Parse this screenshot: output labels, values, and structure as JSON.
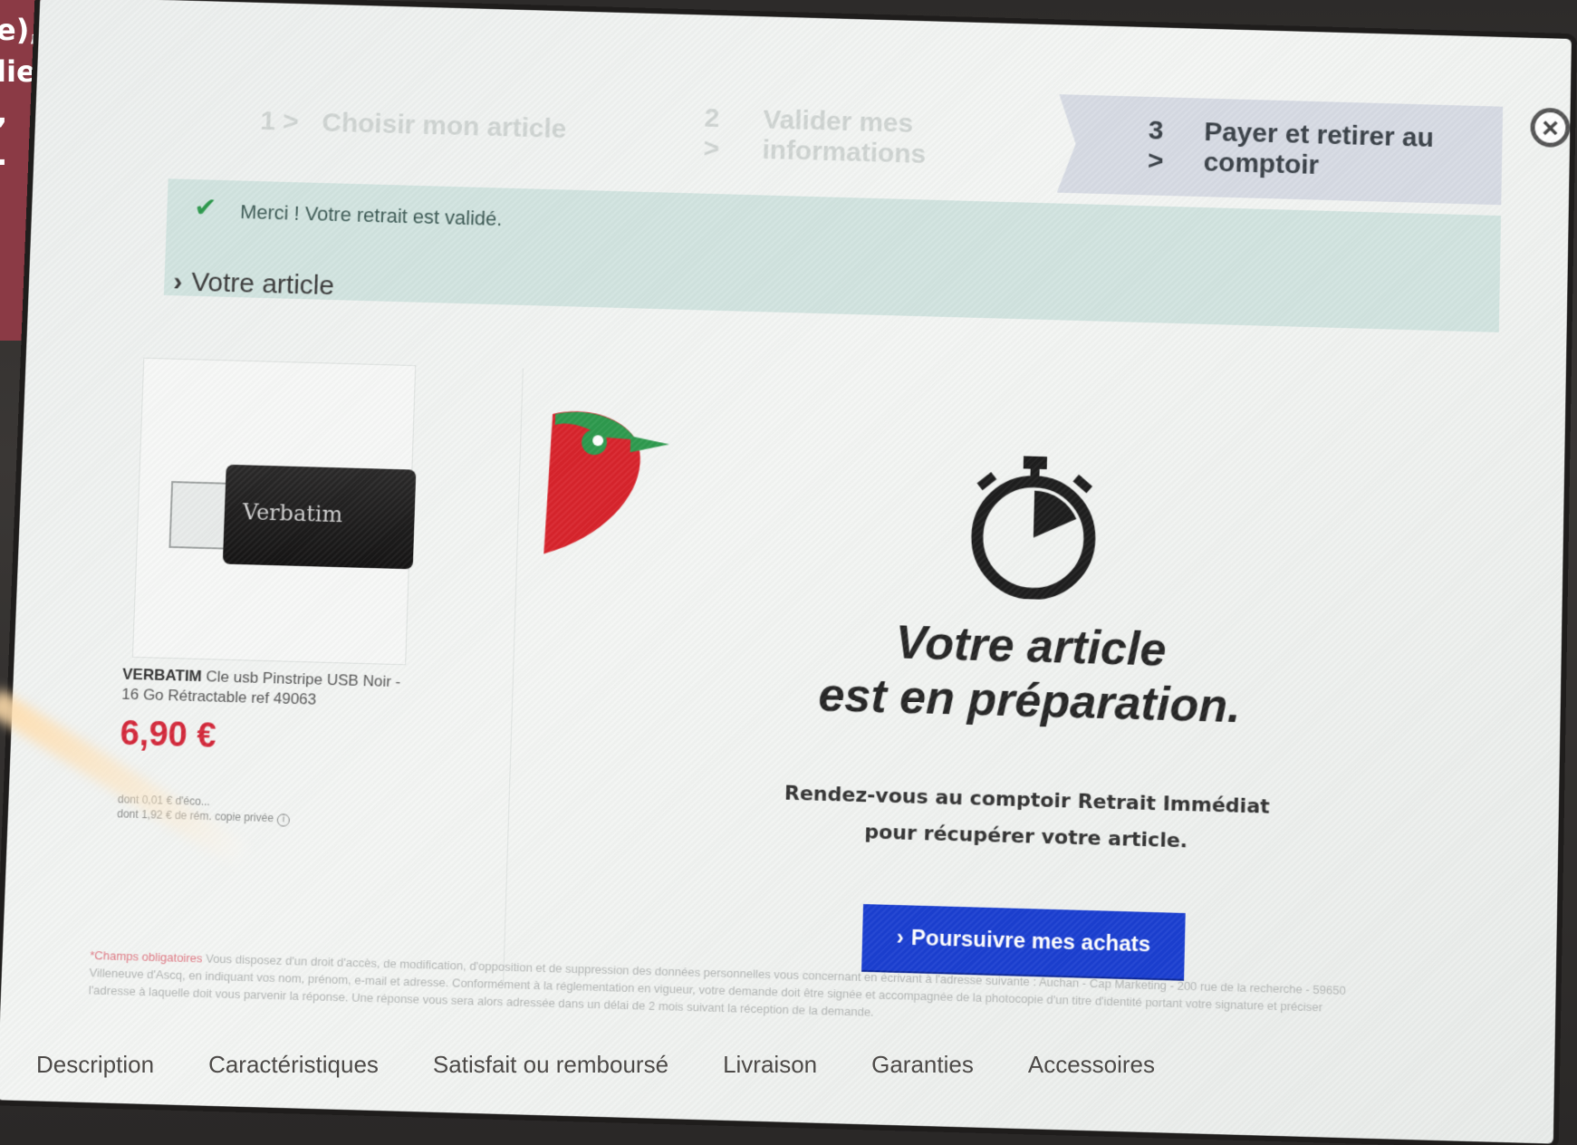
{
  "overlay": {
    "lines": [
      "e),",
      "lient",
      ",",
      "."
    ]
  },
  "wizard": {
    "steps": [
      {
        "num": "1 >",
        "label": "Choisir mon article"
      },
      {
        "num": "2 >",
        "label": "Valider mes informations"
      },
      {
        "num": "3 >",
        "label": "Payer et retirer au comptoir"
      }
    ],
    "active_step": 3
  },
  "success_message": "Merci ! Votre retrait est validé.",
  "section_title": "Votre article",
  "product": {
    "brand": "VERBATIM",
    "name": "Cle usb Pinstripe USB Noir - 16 Go Rétractable ref 49063",
    "image_brand": "Verbatim",
    "price": "6,90 €",
    "fine_print_1": "dont 0,01 € d'éco...",
    "fine_print_2": "dont 1,92 € de rém. copie privée"
  },
  "status": {
    "headline_1": "Votre article",
    "headline_2": "est en préparation.",
    "sub_1": "Rendez-vous au comptoir Retrait Immédiat",
    "sub_2": "pour récupérer votre article."
  },
  "cta_label": "Poursuivre mes achats",
  "legal": {
    "required": "*Champs obligatoires",
    "text": " Vous disposez d'un droit d'accès, de modification, d'opposition et de suppression des données personnelles vous concernant en écrivant à l'adresse suivante : Auchan - Cap Marketing - 200 rue de la recherche - 59650 Villeneuve d'Ascq, en indiquant vos nom, prénom, e-mail et adresse. Conformément à la réglementation en vigueur, votre demande doit être signée et accompagnée de la photocopie d'un titre d'identité portant votre signature et préciser l'adresse à laquelle doit vous parvenir la réponse. Une réponse vous sera alors adressée dans un délai de 2 mois suivant la réception de la demande."
  },
  "bottom_tabs": [
    "Description",
    "Caractéristiques",
    "Satisfait ou remboursé",
    "Livraison",
    "Garanties",
    "Accessoires"
  ],
  "colors": {
    "overlay": "#8b3a45",
    "active_step_bg": "#d7dbe4",
    "success_bg": "#d2e4e0",
    "check": "#2e9a4e",
    "price": "#d4283a",
    "cta": "#1b3fd1",
    "bird_red": "#d8242c",
    "bird_green": "#2e9a4e"
  }
}
